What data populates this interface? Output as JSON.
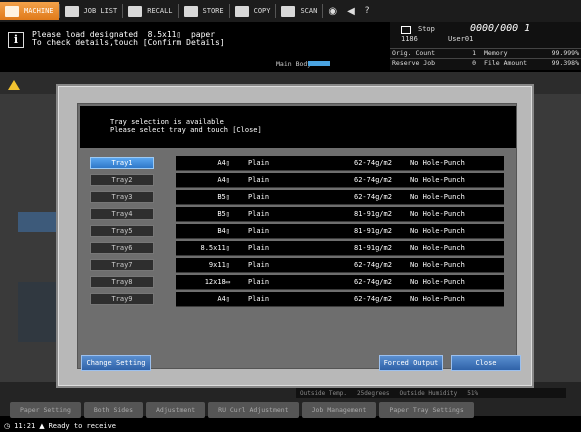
{
  "top_tabs": [
    {
      "label": "MACHINE",
      "icon": "machine-icon",
      "active": true
    },
    {
      "label": "JOB LIST",
      "icon": "job-list-icon",
      "active": false
    },
    {
      "label": "RECALL",
      "icon": "recall-icon",
      "active": false
    },
    {
      "label": "STORE",
      "icon": "store-icon",
      "active": false
    },
    {
      "label": "COPY",
      "icon": "copy-icon",
      "active": false
    },
    {
      "label": "SCAN",
      "icon": "scan-icon",
      "active": false
    }
  ],
  "message": {
    "line1": "Please load designated  8.5x11▯  paper",
    "line2": "To check details,touch [Confirm Details]",
    "main_body_label": "Main Body"
  },
  "status": {
    "state": "Stop",
    "counter": "0000/000 1",
    "kbd": "1186",
    "user": "User01",
    "orig_count_label": "Orig. Count",
    "orig_count_value": "1",
    "memory_label": "Memory",
    "memory_value": "99.999%",
    "reserve_job_label": "Reserve Job",
    "reserve_job_value": "0",
    "file_amount_label": "File Amount",
    "file_amount_value": "99.398%"
  },
  "background": {
    "outside_temp_label": "Outside Temp.",
    "outside_temp_value": "25degrees",
    "outside_humidity_label": "Outside Humidity",
    "outside_humidity_value": "51%",
    "bottom_tabs": [
      "Paper Setting",
      "Both Sides",
      "Adjustment",
      "RU Curl Adjustment",
      "Job Management",
      "Paper Tray Settings"
    ],
    "status_time": "11:21",
    "status_text": "Ready to receive"
  },
  "dialog": {
    "message_line1": "Tray selection is available",
    "message_line2": "Please select tray and touch [Close]",
    "trays": [
      {
        "label": "Tray1",
        "selected": true,
        "size": "A4▯",
        "type": "Plain",
        "weight": "62-74g/m2",
        "punch": "No Hole-Punch"
      },
      {
        "label": "Tray2",
        "selected": false,
        "size": "A4▯",
        "type": "Plain",
        "weight": "62-74g/m2",
        "punch": "No Hole-Punch"
      },
      {
        "label": "Tray3",
        "selected": false,
        "size": "B5▯",
        "type": "Plain",
        "weight": "62-74g/m2",
        "punch": "No Hole-Punch"
      },
      {
        "label": "Tray4",
        "selected": false,
        "size": "B5▯",
        "type": "Plain",
        "weight": "81-91g/m2",
        "punch": "No Hole-Punch"
      },
      {
        "label": "Tray5",
        "selected": false,
        "size": "B4▯",
        "type": "Plain",
        "weight": "81-91g/m2",
        "punch": "No Hole-Punch"
      },
      {
        "label": "Tray6",
        "selected": false,
        "size": "8.5x11▯",
        "type": "Plain",
        "weight": "81-91g/m2",
        "punch": "No Hole-Punch"
      },
      {
        "label": "Tray7",
        "selected": false,
        "size": "9x11▯",
        "type": "Plain",
        "weight": "62-74g/m2",
        "punch": "No Hole-Punch"
      },
      {
        "label": "Tray8",
        "selected": false,
        "size": "12x18▭",
        "type": "Plain",
        "weight": "62-74g/m2",
        "punch": "No Hole-Punch"
      },
      {
        "label": "Tray9",
        "selected": false,
        "size": "A4▯",
        "type": "Plain",
        "weight": "62-74g/m2",
        "punch": "No Hole-Punch"
      }
    ],
    "change_setting_label": "Change Setting",
    "forced_output_label": "Forced Output",
    "close_label": "Close"
  },
  "colors": {
    "active_tab": "#e8892a",
    "selected_tray": "#3c8ad8",
    "dialog_button": "#3f74bb"
  }
}
